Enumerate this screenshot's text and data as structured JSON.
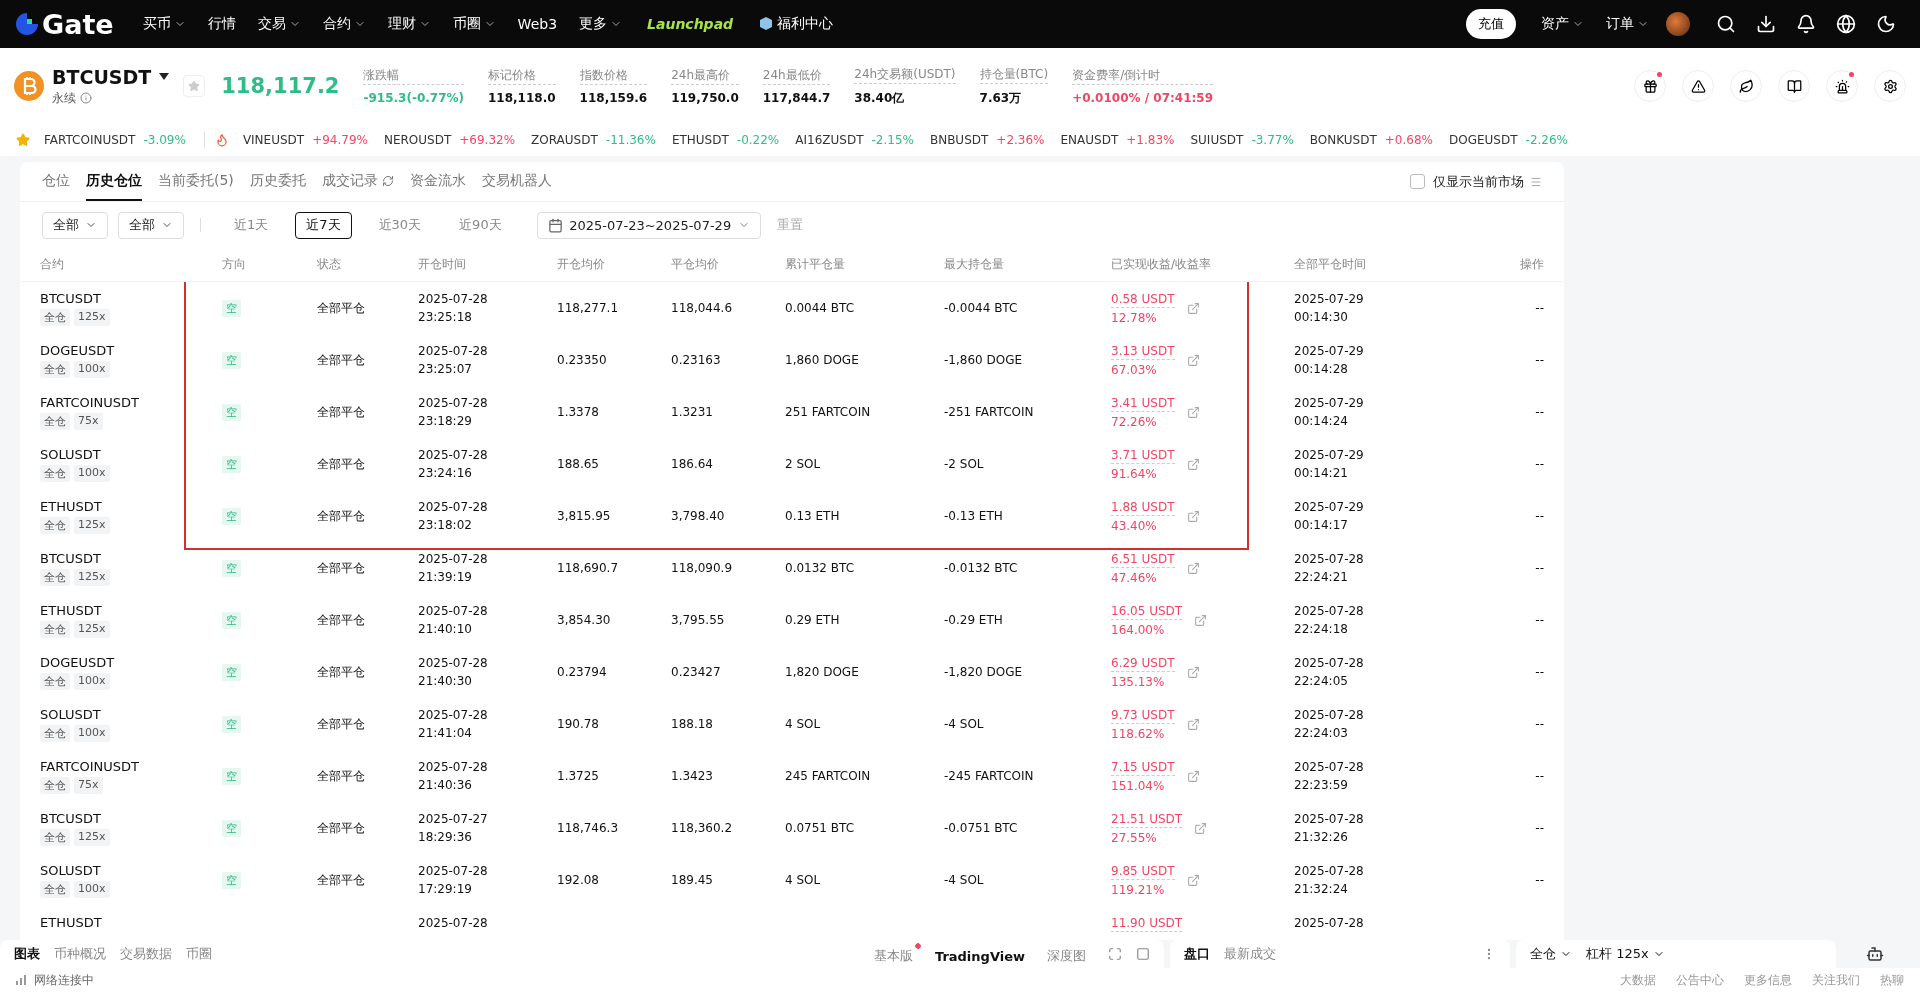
{
  "nav": {
    "logo": "Gate",
    "items": [
      {
        "label": "买币",
        "menu": true
      },
      {
        "label": "行情",
        "menu": false
      },
      {
        "label": "交易",
        "menu": true
      },
      {
        "label": "合约",
        "menu": true
      },
      {
        "label": "理财",
        "menu": true
      },
      {
        "label": "币圈",
        "menu": true
      },
      {
        "label": "Web3",
        "menu": false
      },
      {
        "label": "更多",
        "menu": true
      }
    ],
    "launchpad": "Launchpad",
    "welfare": "福利中心",
    "deposit": "充值",
    "assets": "资产",
    "orders": "订单"
  },
  "market": {
    "symbol": "BTCUSDT",
    "type": "永续",
    "price": "118,117.2",
    "stats": [
      {
        "label": "涨跌幅",
        "value": "-915.3(-0.77%)",
        "color": "#2dbd85"
      },
      {
        "label": "标记价格",
        "value": "118,118.0",
        "color": "#111111"
      },
      {
        "label": "指数价格",
        "value": "118,159.6",
        "color": "#111111"
      },
      {
        "label": "24h最高价",
        "value": "119,750.0",
        "color": "#111111"
      },
      {
        "label": "24h最低价",
        "value": "117,844.7",
        "color": "#111111"
      },
      {
        "label": "24h交易额(USDT)",
        "value": "38.40亿",
        "color": "#111111"
      },
      {
        "label": "持仓量(BTC)",
        "value": "7.63万",
        "color": "#111111"
      },
      {
        "label": "资金费率/倒计时",
        "value": "+0.0100% / 07:41:59",
        "color": "#f0465f"
      }
    ]
  },
  "ticker": [
    {
      "symbol": "FARTCOINUSDT",
      "change": "-3.09%",
      "color": "#2dbd85"
    },
    {
      "symbol": "VINEUSDT",
      "change": "+94.79%",
      "color": "#f0465f"
    },
    {
      "symbol": "NEROUSDT",
      "change": "+69.32%",
      "color": "#f0465f"
    },
    {
      "symbol": "ZORAUSDT",
      "change": "-11.36%",
      "color": "#2dbd85"
    },
    {
      "symbol": "ETHUSDT",
      "change": "-0.22%",
      "color": "#2dbd85"
    },
    {
      "symbol": "AI16ZUSDT",
      "change": "-2.15%",
      "color": "#2dbd85"
    },
    {
      "symbol": "BNBUSDT",
      "change": "+2.36%",
      "color": "#f0465f"
    },
    {
      "symbol": "ENAUSDT",
      "change": "+1.83%",
      "color": "#f0465f"
    },
    {
      "symbol": "SUIUSDT",
      "change": "-3.77%",
      "color": "#2dbd85"
    },
    {
      "symbol": "BONKUSDT",
      "change": "+0.68%",
      "color": "#f0465f"
    },
    {
      "symbol": "DOGEUSDT",
      "change": "-2.26%",
      "color": "#2dbd85"
    }
  ],
  "tabs": [
    {
      "label": "仓位",
      "selected": false
    },
    {
      "label": "历史仓位",
      "selected": true
    },
    {
      "label": "当前委托(5)",
      "selected": false
    },
    {
      "label": "历史委托",
      "selected": false
    },
    {
      "label": "成交记录",
      "selected": false
    },
    {
      "label": "资金流水",
      "selected": false
    },
    {
      "label": "交易机器人",
      "selected": false
    }
  ],
  "only_current": {
    "label": "仅显示当前市场",
    "checked": false
  },
  "filters": {
    "selects": [
      "全部",
      "全部"
    ],
    "ranges": [
      {
        "label": "近1天",
        "selected": false
      },
      {
        "label": "近7天",
        "selected": true
      },
      {
        "label": "近30天",
        "selected": false
      },
      {
        "label": "近90天",
        "selected": false
      }
    ],
    "date_range": "2025-07-23~2025-07-29",
    "reset": "重置"
  },
  "table": {
    "columns": [
      "合约",
      "方向",
      "状态",
      "开仓时间",
      "开仓均价",
      "平仓均价",
      "累计平仓量",
      "最大持仓量",
      "已实现收益/收益率",
      "全部平仓时间",
      "操作"
    ],
    "highlighted_rows": [
      {
        "symbol": "BTCUSDT",
        "margin": "全仓",
        "leverage": "125x",
        "side": "空",
        "status": "全部平仓",
        "open_date": "2025-07-28",
        "open_time": "23:25:18",
        "open_price": "118,277.1",
        "close_price": "118,044.6",
        "closed": "0.0044 BTC",
        "max": "-0.0044 BTC",
        "pnl": "0.58 USDT",
        "rate": "12.78%",
        "close_date": "2025-07-29",
        "close_time": "00:14:30",
        "action": "--"
      },
      {
        "symbol": "DOGEUSDT",
        "margin": "全仓",
        "leverage": "100x",
        "side": "空",
        "status": "全部平仓",
        "open_date": "2025-07-28",
        "open_time": "23:25:07",
        "open_price": "0.23350",
        "close_price": "0.23163",
        "closed": "1,860 DOGE",
        "max": "-1,860 DOGE",
        "pnl": "3.13 USDT",
        "rate": "67.03%",
        "close_date": "2025-07-29",
        "close_time": "00:14:28",
        "action": "--"
      },
      {
        "symbol": "FARTCOINUSDT",
        "margin": "全仓",
        "leverage": "75x",
        "side": "空",
        "status": "全部平仓",
        "open_date": "2025-07-28",
        "open_time": "23:18:29",
        "open_price": "1.3378",
        "close_price": "1.3231",
        "closed": "251 FARTCOIN",
        "max": "-251 FARTCOIN",
        "pnl": "3.41 USDT",
        "rate": "72.26%",
        "close_date": "2025-07-29",
        "close_time": "00:14:24",
        "action": "--"
      },
      {
        "symbol": "SOLUSDT",
        "margin": "全仓",
        "leverage": "100x",
        "side": "空",
        "status": "全部平仓",
        "open_date": "2025-07-28",
        "open_time": "23:24:16",
        "open_price": "188.65",
        "close_price": "186.64",
        "closed": "2 SOL",
        "max": "-2 SOL",
        "pnl": "3.71 USDT",
        "rate": "91.64%",
        "close_date": "2025-07-29",
        "close_time": "00:14:21",
        "action": "--"
      },
      {
        "symbol": "ETHUSDT",
        "margin": "全仓",
        "leverage": "125x",
        "side": "空",
        "status": "全部平仓",
        "open_date": "2025-07-28",
        "open_time": "23:18:02",
        "open_price": "3,815.95",
        "close_price": "3,798.40",
        "closed": "0.13 ETH",
        "max": "-0.13 ETH",
        "pnl": "1.88 USDT",
        "rate": "43.40%",
        "close_date": "2025-07-29",
        "close_time": "00:14:17",
        "action": "--"
      }
    ],
    "rows": [
      {
        "symbol": "BTCUSDT",
        "margin": "全仓",
        "leverage": "125x",
        "side": "空",
        "status": "全部平仓",
        "open_date": "2025-07-28",
        "open_time": "21:39:19",
        "open_price": "118,690.7",
        "close_price": "118,090.9",
        "closed": "0.0132 BTC",
        "max": "-0.0132 BTC",
        "pnl": "6.51 USDT",
        "rate": "47.46%",
        "close_date": "2025-07-28",
        "close_time": "22:24:21",
        "action": "--"
      },
      {
        "symbol": "ETHUSDT",
        "margin": "全仓",
        "leverage": "125x",
        "side": "空",
        "status": "全部平仓",
        "open_date": "2025-07-28",
        "open_time": "21:40:10",
        "open_price": "3,854.30",
        "close_price": "3,795.55",
        "closed": "0.29 ETH",
        "max": "-0.29 ETH",
        "pnl": "16.05 USDT",
        "rate": "164.00%",
        "close_date": "2025-07-28",
        "close_time": "22:24:18",
        "action": "--"
      },
      {
        "symbol": "DOGEUSDT",
        "margin": "全仓",
        "leverage": "100x",
        "side": "空",
        "status": "全部平仓",
        "open_date": "2025-07-28",
        "open_time": "21:40:30",
        "open_price": "0.23794",
        "close_price": "0.23427",
        "closed": "1,820 DOGE",
        "max": "-1,820 DOGE",
        "pnl": "6.29 USDT",
        "rate": "135.13%",
        "close_date": "2025-07-28",
        "close_time": "22:24:05",
        "action": "--"
      },
      {
        "symbol": "SOLUSDT",
        "margin": "全仓",
        "leverage": "100x",
        "side": "空",
        "status": "全部平仓",
        "open_date": "2025-07-28",
        "open_time": "21:41:04",
        "open_price": "190.78",
        "close_price": "188.18",
        "closed": "4 SOL",
        "max": "-4 SOL",
        "pnl": "9.73 USDT",
        "rate": "118.62%",
        "close_date": "2025-07-28",
        "close_time": "22:24:03",
        "action": "--"
      },
      {
        "symbol": "FARTCOINUSDT",
        "margin": "全仓",
        "leverage": "75x",
        "side": "空",
        "status": "全部平仓",
        "open_date": "2025-07-28",
        "open_time": "21:40:36",
        "open_price": "1.3725",
        "close_price": "1.3423",
        "closed": "245 FARTCOIN",
        "max": "-245 FARTCOIN",
        "pnl": "7.15 USDT",
        "rate": "151.04%",
        "close_date": "2025-07-28",
        "close_time": "22:23:59",
        "action": "--"
      },
      {
        "symbol": "BTCUSDT",
        "margin": "全仓",
        "leverage": "125x",
        "side": "空",
        "status": "全部平仓",
        "open_date": "2025-07-27",
        "open_time": "18:29:36",
        "open_price": "118,746.3",
        "close_price": "118,360.2",
        "closed": "0.0751 BTC",
        "max": "-0.0751 BTC",
        "pnl": "21.51 USDT",
        "rate": "27.55%",
        "close_date": "2025-07-28",
        "close_time": "21:32:26",
        "action": "--"
      },
      {
        "symbol": "SOLUSDT",
        "margin": "全仓",
        "leverage": "100x",
        "side": "空",
        "status": "全部平仓",
        "open_date": "2025-07-28",
        "open_time": "17:29:19",
        "open_price": "192.08",
        "close_price": "189.45",
        "closed": "4 SOL",
        "max": "-4 SOL",
        "pnl": "9.85 USDT",
        "rate": "119.21%",
        "close_date": "2025-07-28",
        "close_time": "21:32:24",
        "action": "--"
      },
      {
        "symbol": "ETHUSDT",
        "open_date": "2025-07-28",
        "pnl": "11.90 USDT",
        "close_date": "2025-07-28"
      }
    ]
  },
  "bottom": {
    "chart_tabs": [
      {
        "label": "图表",
        "selected": true
      },
      {
        "label": "币种概况",
        "selected": false
      },
      {
        "label": "交易数据",
        "selected": false
      },
      {
        "label": "币圈",
        "selected": false
      }
    ],
    "views": [
      {
        "label": "基本版",
        "selected": false,
        "dot": true
      },
      {
        "label": "TradingView",
        "selected": true,
        "dot": false
      },
      {
        "label": "深度图",
        "selected": false,
        "dot": false
      }
    ],
    "book_tabs": [
      {
        "label": "盘口",
        "selected": true
      },
      {
        "label": "最新成交",
        "selected": false
      }
    ],
    "margin_mode": "全仓",
    "leverage": "杠杆 125x"
  },
  "status": {
    "connection": "网络连接中",
    "links": [
      "大数据",
      "公告中心",
      "更多信息",
      "关注我们",
      "热聊"
    ]
  }
}
